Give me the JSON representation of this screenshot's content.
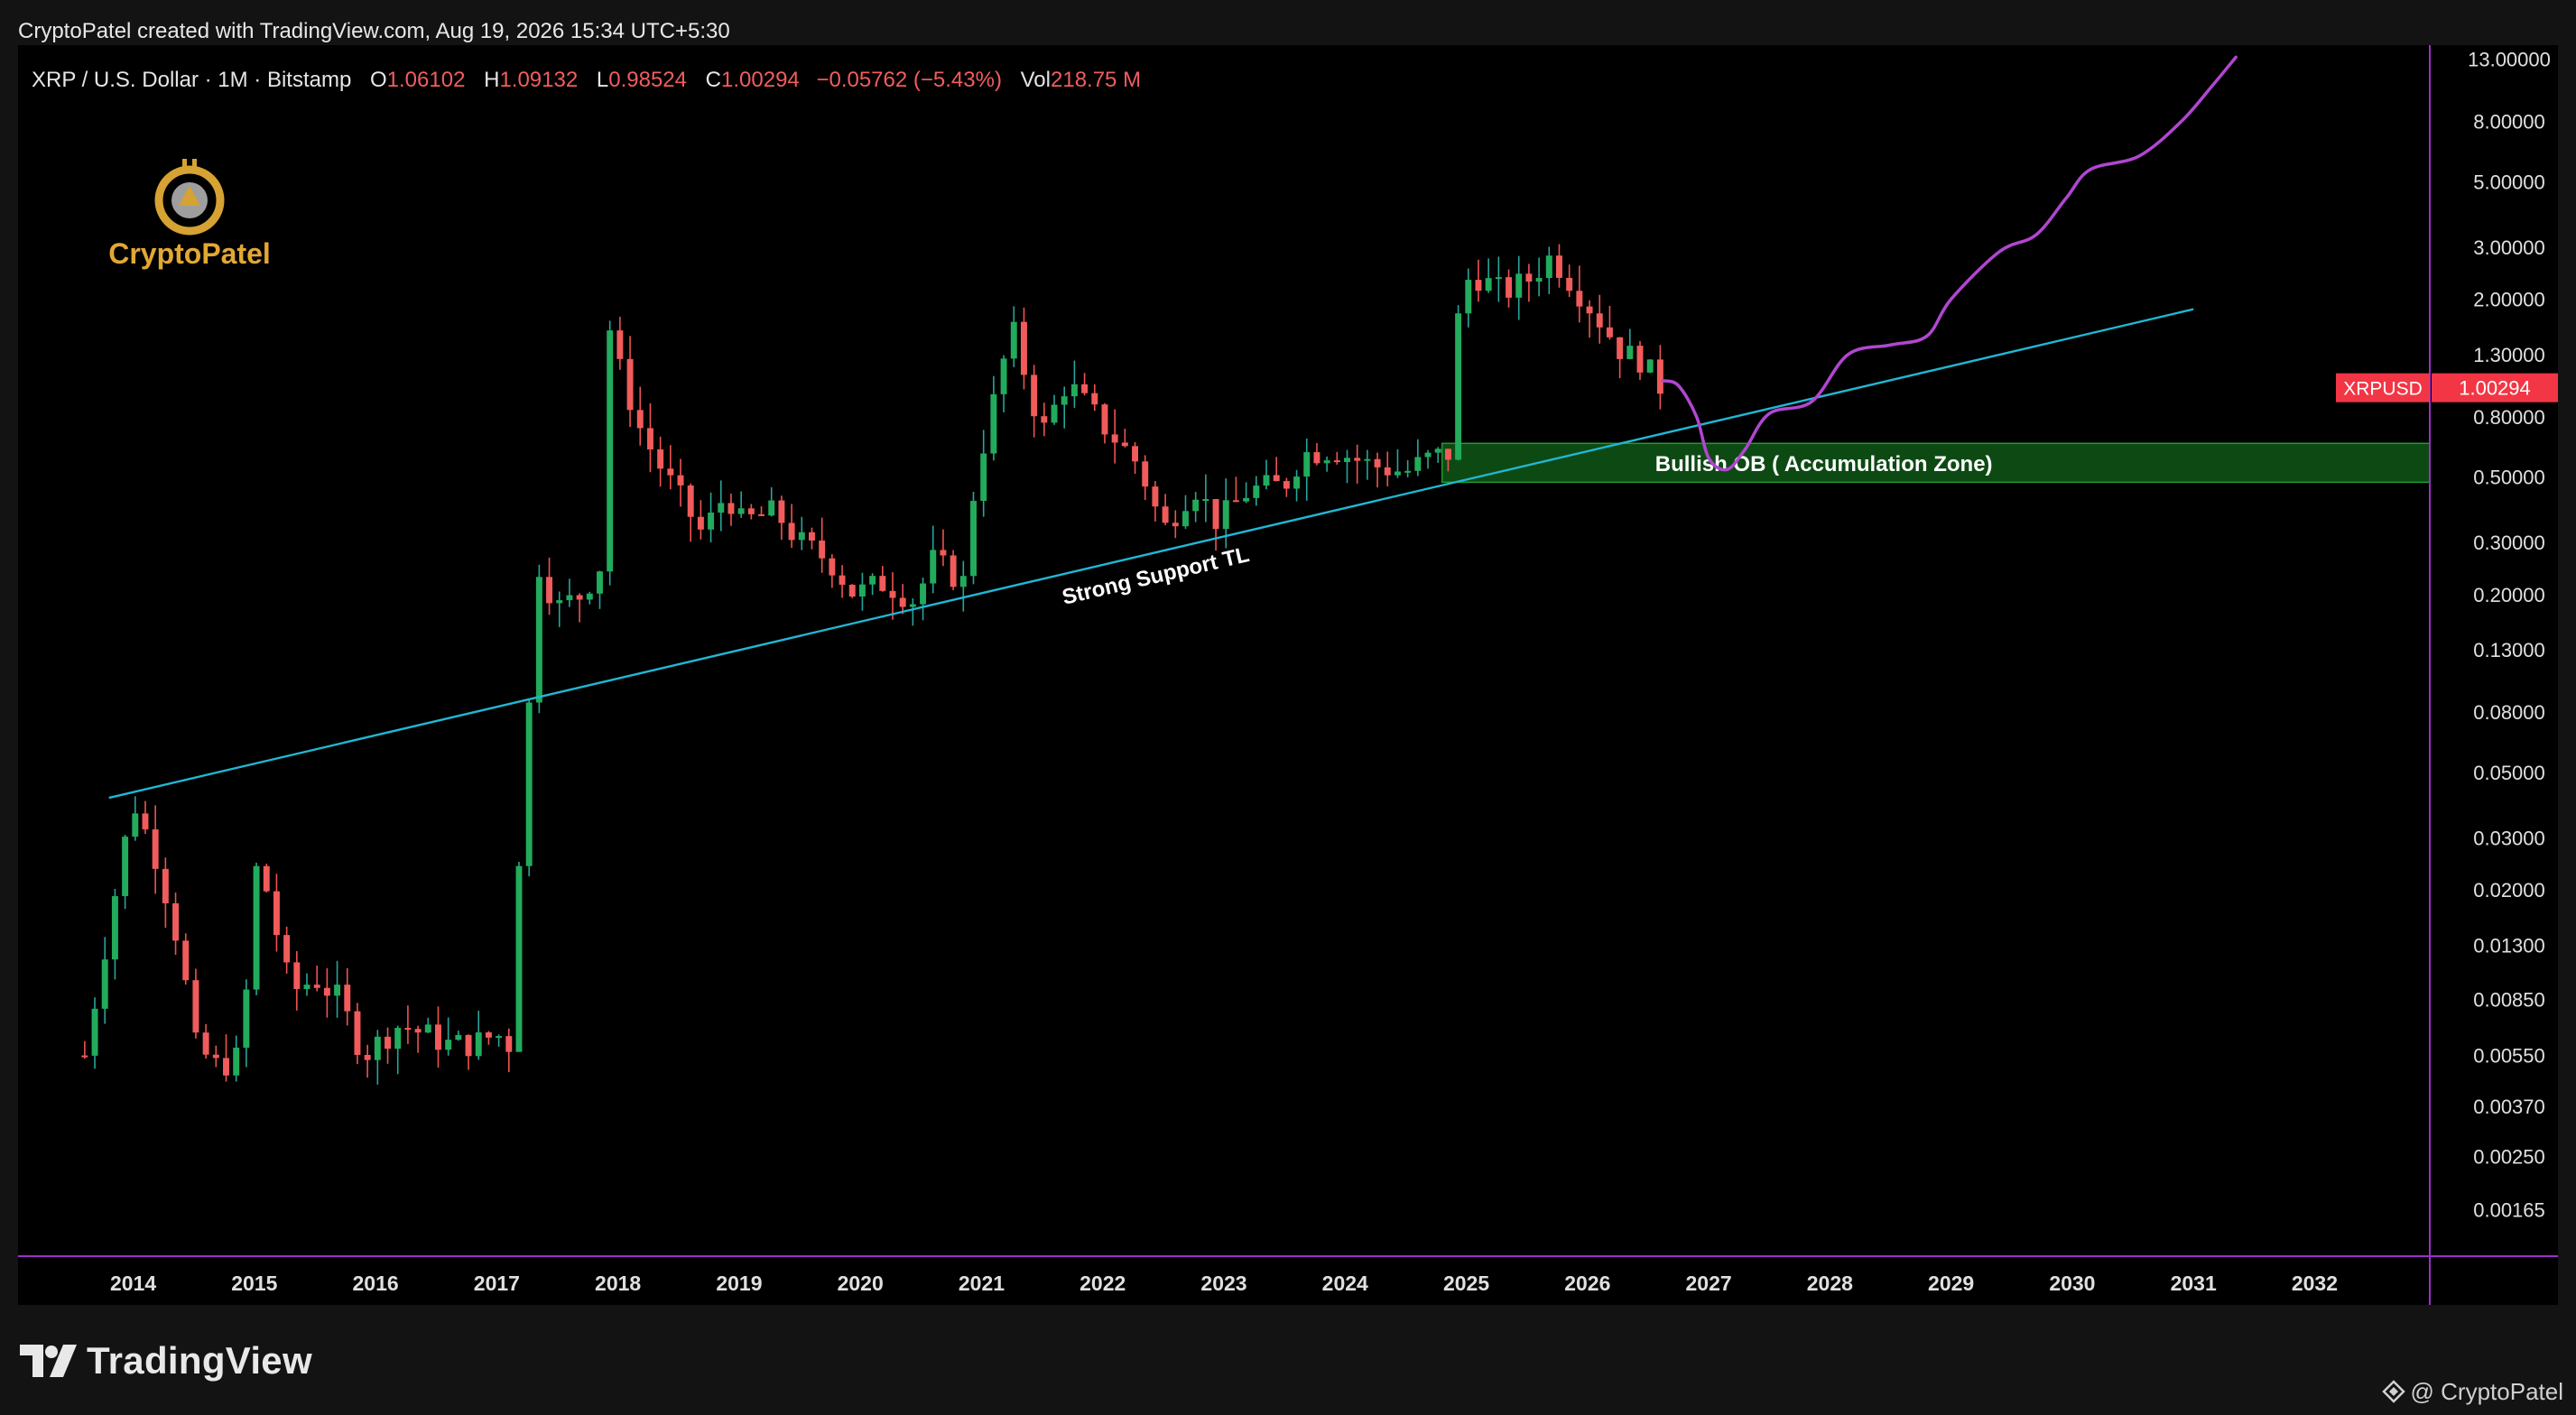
{
  "page": {
    "header_text": "CryptoPatel created with TradingView.com, Aug 19, 2026 15:34 UTC+5:30",
    "footer_brand": "TradingView",
    "footer_credit": "@ CryptoPatel",
    "watermark_logo_text": "CryptoPatel"
  },
  "chart_data": {
    "type": "candlestick",
    "legend": {
      "symbol": "XRP / U.S. Dollar · 1M · Bitstamp",
      "o_label": "O",
      "o_value": "1.06102",
      "h_label": "H",
      "h_value": "1.09132",
      "l_label": "L",
      "l_value": "0.98524",
      "c_label": "C",
      "c_value": "1.00294",
      "change": "−0.05762 (−5.43%)",
      "vol_label": "Vol",
      "vol_value": "218.75 M"
    },
    "price_tag": {
      "symbol": "XRPUSD",
      "value": "1.00294",
      "price": 1.00294
    },
    "y_scale": "log",
    "y_range": [
      0.00115,
      14.5
    ],
    "y_ticks": [
      {
        "label": "13.00000",
        "v": 13
      },
      {
        "label": "8.00000",
        "v": 8
      },
      {
        "label": "5.00000",
        "v": 5
      },
      {
        "label": "3.00000",
        "v": 3
      },
      {
        "label": "2.00000",
        "v": 2
      },
      {
        "label": "1.30000",
        "v": 1.3
      },
      {
        "label": "0.80000",
        "v": 0.8
      },
      {
        "label": "0.50000",
        "v": 0.5
      },
      {
        "label": "0.30000",
        "v": 0.3
      },
      {
        "label": "0.20000",
        "v": 0.2
      },
      {
        "label": "0.13000",
        "v": 0.13
      },
      {
        "label": "0.08000",
        "v": 0.08
      },
      {
        "label": "0.05000",
        "v": 0.05
      },
      {
        "label": "0.03000",
        "v": 0.03
      },
      {
        "label": "0.02000",
        "v": 0.02
      },
      {
        "label": "0.01300",
        "v": 0.013
      },
      {
        "label": "0.00850",
        "v": 0.0085
      },
      {
        "label": "0.00550",
        "v": 0.0055
      },
      {
        "label": "0.00370",
        "v": 0.0037
      },
      {
        "label": "0.00250",
        "v": 0.0025
      },
      {
        "label": "0.00165",
        "v": 0.00165
      }
    ],
    "x_range": [
      2013.05,
      2032.95
    ],
    "x_ticks": [
      {
        "label": "2014",
        "v": 2014
      },
      {
        "label": "2015",
        "v": 2015
      },
      {
        "label": "2016",
        "v": 2016
      },
      {
        "label": "2017",
        "v": 2017
      },
      {
        "label": "2018",
        "v": 2018
      },
      {
        "label": "2019",
        "v": 2019
      },
      {
        "label": "2020",
        "v": 2020
      },
      {
        "label": "2021",
        "v": 2021
      },
      {
        "label": "2022",
        "v": 2022
      },
      {
        "label": "2023",
        "v": 2023
      },
      {
        "label": "2024",
        "v": 2024
      },
      {
        "label": "2025",
        "v": 2025
      },
      {
        "label": "2026",
        "v": 2026
      },
      {
        "label": "2027",
        "v": 2027
      },
      {
        "label": "2028",
        "v": 2028
      },
      {
        "label": "2029",
        "v": 2029
      },
      {
        "label": "2030",
        "v": 2030
      },
      {
        "label": "2031",
        "v": 2031
      },
      {
        "label": "2032",
        "v": 2032
      }
    ],
    "close_path": [
      [
        2013.6,
        0.0055
      ],
      [
        2013.9,
        0.025
      ],
      [
        2014.0,
        0.04
      ],
      [
        2014.2,
        0.025
      ],
      [
        2014.4,
        0.012
      ],
      [
        2014.5,
        0.006
      ],
      [
        2014.7,
        0.005
      ],
      [
        2014.9,
        0.0055
      ],
      [
        2015.0,
        0.024
      ],
      [
        2015.1,
        0.02
      ],
      [
        2015.3,
        0.009
      ],
      [
        2015.5,
        0.01
      ],
      [
        2015.7,
        0.0085
      ],
      [
        2015.9,
        0.0055
      ],
      [
        2016.2,
        0.007
      ],
      [
        2016.4,
        0.0065
      ],
      [
        2016.6,
        0.006
      ],
      [
        2016.8,
        0.006
      ],
      [
        2017.0,
        0.0065
      ],
      [
        2017.1,
        0.006
      ],
      [
        2017.2,
        0.035
      ],
      [
        2017.35,
        0.25
      ],
      [
        2017.5,
        0.18
      ],
      [
        2017.7,
        0.2
      ],
      [
        2017.85,
        0.25
      ],
      [
        2017.95,
        2.3
      ],
      [
        2018.0,
        1.2
      ],
      [
        2018.2,
        0.7
      ],
      [
        2018.4,
        0.5
      ],
      [
        2018.7,
        0.32
      ],
      [
        2018.9,
        0.45
      ],
      [
        2019.0,
        0.35
      ],
      [
        2019.3,
        0.38
      ],
      [
        2019.5,
        0.3
      ],
      [
        2019.75,
        0.26
      ],
      [
        2019.95,
        0.2
      ],
      [
        2020.2,
        0.22
      ],
      [
        2020.45,
        0.19
      ],
      [
        2020.6,
        0.26
      ],
      [
        2020.85,
        0.22
      ],
      [
        2020.95,
        0.5
      ],
      [
        2021.25,
        1.6
      ],
      [
        2021.5,
        0.7
      ],
      [
        2021.7,
        1.05
      ],
      [
        2022.0,
        0.75
      ],
      [
        2022.3,
        0.55
      ],
      [
        2022.5,
        0.33
      ],
      [
        2022.75,
        0.47
      ],
      [
        2022.95,
        0.35
      ],
      [
        2023.2,
        0.45
      ],
      [
        2023.5,
        0.47
      ],
      [
        2023.65,
        0.6
      ],
      [
        2023.9,
        0.62
      ],
      [
        2024.2,
        0.55
      ],
      [
        2024.5,
        0.52
      ],
      [
        2024.7,
        0.58
      ],
      [
        2024.85,
        0.6
      ],
      [
        2024.95,
        2.1
      ],
      [
        2025.05,
        2.45
      ],
      [
        2025.3,
        2.1
      ],
      [
        2025.5,
        2.3
      ],
      [
        2025.7,
        2.8
      ],
      [
        2025.9,
        2.2
      ],
      [
        2026.1,
        1.7
      ],
      [
        2026.3,
        1.3
      ],
      [
        2026.45,
        1.25
      ],
      [
        2026.55,
        1.06
      ],
      [
        2026.62,
        1.0
      ]
    ],
    "projection": [
      [
        2026.62,
        1.06
      ],
      [
        2026.75,
        1.02
      ],
      [
        2026.9,
        0.8
      ],
      [
        2027.0,
        0.58
      ],
      [
        2027.15,
        0.53
      ],
      [
        2027.3,
        0.62
      ],
      [
        2027.5,
        0.82
      ],
      [
        2027.85,
        0.9
      ],
      [
        2028.15,
        1.3
      ],
      [
        2028.5,
        1.4
      ],
      [
        2028.8,
        1.5
      ],
      [
        2029.0,
        2.0
      ],
      [
        2029.4,
        2.9
      ],
      [
        2029.7,
        3.3
      ],
      [
        2029.95,
        4.4
      ],
      [
        2030.15,
        5.5
      ],
      [
        2030.55,
        6.1
      ],
      [
        2030.9,
        8.0
      ],
      [
        2031.15,
        10.5
      ],
      [
        2031.35,
        13.2
      ]
    ],
    "trendline": {
      "label": "Strong Support TL",
      "start": [
        2013.8,
        0.041
      ],
      "end": [
        2031.0,
        1.85
      ]
    },
    "zone": {
      "label": "Bullish OB ( Accumulation Zone)",
      "x_start": 2024.8,
      "y_top": 0.65,
      "y_bottom": 0.48
    },
    "colors": {
      "up": "#26a69a",
      "down": "#ef5350",
      "up_body": "#22ab5c",
      "down_body": "#f15b5b",
      "trendline": "#21b7d3",
      "projection": "#b146d1",
      "zone": "#0d4a13",
      "zone_border": "#1f9c32",
      "border": "#9c2fc9",
      "price_tag": "#f23645"
    },
    "grid": false
  }
}
